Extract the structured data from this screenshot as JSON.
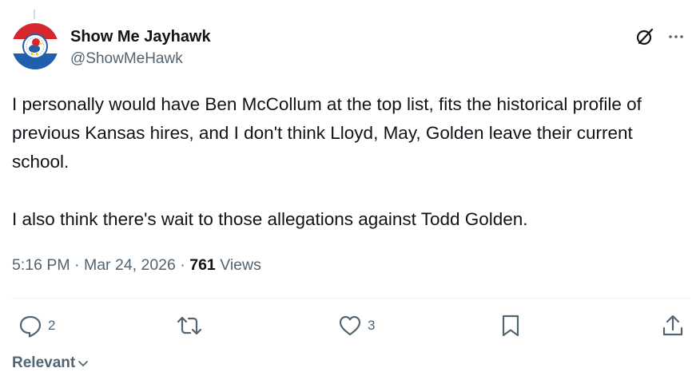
{
  "author": {
    "display_name": "Show Me Jayhawk",
    "handle": "@ShowMeHawk",
    "avatar_icon": "jayhawk-mascot-avatar"
  },
  "tweet": {
    "text": "I personally would have Ben McCollum at the top list, fits the historical profile of previous Kansas hires, and I don't think Lloyd, May, Golden leave their current school.\n\nI also think there's wait to those allegations against Todd Golden.",
    "time": "5:16 PM",
    "separator": "·",
    "date": "Mar 24, 2026",
    "views_count": "761",
    "views_label": "Views"
  },
  "actions": {
    "reply_count": "2",
    "retweet_count": "",
    "like_count": "3"
  },
  "icons": [
    "grok-icon",
    "more-icon",
    "reply-icon",
    "retweet-icon",
    "like-icon",
    "bookmark-icon",
    "share-icon",
    "chevron-down-icon"
  ],
  "sort": {
    "label": "Relevant"
  },
  "colors": {
    "text": "#0f1419",
    "secondary": "#536471",
    "divider": "#eff3f4",
    "avatar_red": "#d7262e",
    "avatar_blue": "#1f5fae"
  }
}
